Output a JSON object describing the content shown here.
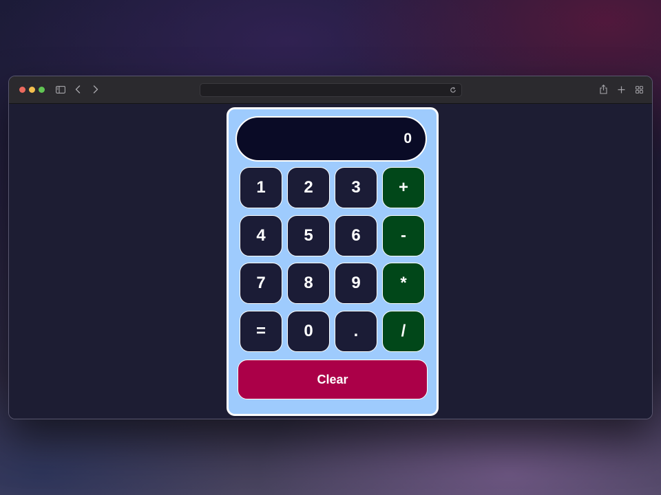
{
  "browser": {
    "url": "",
    "toolbar_icons": [
      "sidebar-icon",
      "back-icon",
      "forward-icon",
      "reload-icon",
      "share-icon",
      "new-tab-icon",
      "tab-overview-icon"
    ]
  },
  "calculator": {
    "display": "0",
    "keys": {
      "k1": "1",
      "k2": "2",
      "k3": "3",
      "plus": "+",
      "k4": "4",
      "k5": "5",
      "k6": "6",
      "minus": "-",
      "k7": "7",
      "k8": "8",
      "k9": "9",
      "multiply": "*",
      "equals": "=",
      "k0": "0",
      "dot": ".",
      "divide": "/"
    },
    "clear_label": "Clear"
  },
  "colors": {
    "panel": "#9ecbfd",
    "display_bg": "#0a0b26",
    "number_key": "#1b1c36",
    "operator_key": "#014719",
    "clear_button": "#ab0048",
    "page_bg": "#1d1d33"
  }
}
